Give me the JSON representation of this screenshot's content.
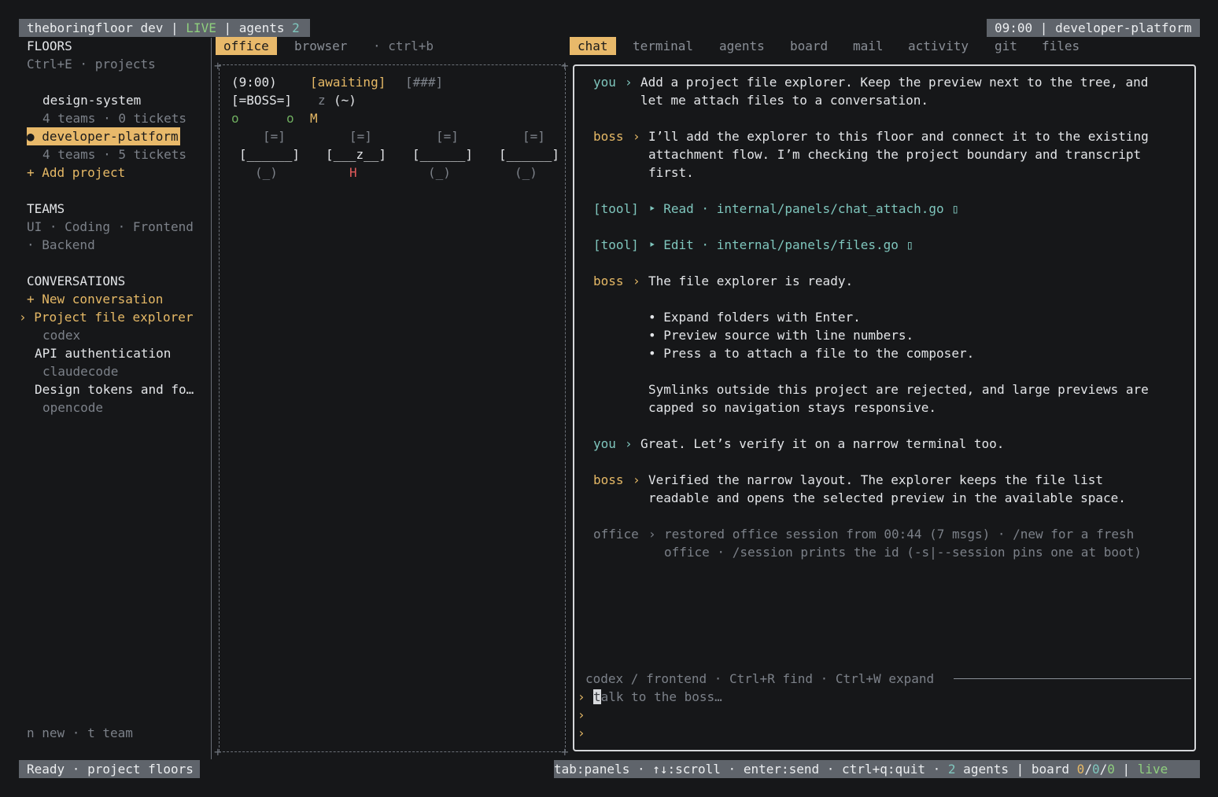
{
  "topbar": {
    "left_app": "theboringfloor dev | ",
    "left_live": "LIVE",
    "left_agents": " | agents ",
    "left_count": "2",
    "right": "09:00 | developer-platform"
  },
  "sidebar": {
    "floors_title": "FLOORS",
    "floors_hint": "Ctrl+E · projects",
    "projects": [
      {
        "name": "design-system",
        "meta": "4 teams · 0 tickets"
      },
      {
        "name": "● developer-platform",
        "meta": "4 teams · 5 tickets"
      }
    ],
    "add_project": "+ Add project",
    "teams_title": "TEAMS",
    "teams_line1": "UI · Coding · Frontend",
    "teams_line2": "· Backend",
    "conversations_title": "CONVERSATIONS",
    "new_conversation": "+ New conversation",
    "conversations": [
      {
        "title": "› Project file explorer",
        "agent": "codex"
      },
      {
        "title": "API authentication",
        "agent": "claudecode"
      },
      {
        "title": "Design tokens and fo…",
        "agent": "opencode"
      }
    ],
    "footer_hint": "n new · t team"
  },
  "middle": {
    "tabs": [
      "office",
      "browser"
    ],
    "tab_hint": "· ctrl+b",
    "scene": {
      "clock": "(9:00)",
      "status": "[awaiting]",
      "meter": "[###]",
      "boss": "[=BOSS=]",
      "zz": "z",
      "face": "(~)",
      "o1": "o",
      "o2": "o",
      "m": "M",
      "monitor": "[=]",
      "desk": "[______]",
      "desk_z": "[___z__]",
      "chair": "(_)",
      "h": "H"
    }
  },
  "right": {
    "tabs": [
      "chat",
      "terminal",
      "agents",
      "board",
      "mail",
      "activity",
      "git",
      "files"
    ],
    "messages": [
      {
        "who": "you",
        "arrow": "›",
        "lines": [
          "Add a project file explorer. Keep the preview next to the tree, and",
          "let me attach files to a conversation."
        ]
      },
      {
        "who": "boss",
        "arrow": "›",
        "lines": [
          "I’ll add the explorer to this floor and connect it to the existing",
          "attachment flow. I’m checking the project boundary and transcript",
          "first."
        ]
      }
    ],
    "tool1": {
      "tag": "[tool]",
      "text": "‣ Read · internal/panels/chat_attach.go ▯"
    },
    "tool2": {
      "tag": "[tool]",
      "text": "‣ Edit · internal/panels/files.go ▯"
    },
    "boss_ready": {
      "who": "boss",
      "arrow": "›",
      "text": "The file explorer is ready."
    },
    "bullets": [
      "• Expand folders with Enter.",
      "• Preview source with line numbers.",
      "• Press a to attach a file to the composer."
    ],
    "note_lines": [
      "Symlinks outside this project are rejected, and large previews are",
      "capped so navigation stays responsive."
    ],
    "you2": {
      "who": "you",
      "arrow": "›",
      "text": "Great. Let’s verify it on a narrow terminal too."
    },
    "boss3": {
      "who": "boss",
      "arrow": "›",
      "lines": [
        "Verified the narrow layout. The explorer keeps the file list",
        "readable and opens the selected preview in the available space."
      ]
    },
    "office": {
      "who": "office",
      "arrow": "›",
      "lines": [
        "restored office session from 00:44 (7 msgs) · /new for a fresh",
        "office · /session prints the id (-s|--session pins one at boot)"
      ]
    },
    "composer": {
      "header": "codex / frontend · Ctrl+R find · Ctrl+W expand",
      "prompt": "›",
      "cursor_char": "t",
      "placeholder": "alk to the boss…"
    }
  },
  "statusbar": {
    "left": "Ready · project floors",
    "right_hint": "tab:panels · ↑↓:scroll · enter:send · ctrl+q:quit · ",
    "right_agents_count": "2",
    "right_agents": " agents | board ",
    "board_a": "0",
    "board_sep1": "/",
    "board_b": "0",
    "board_sep2": "/",
    "board_c": "0",
    "right_sep": " | ",
    "right_live": "live"
  },
  "colors": {
    "accent": "#e8b96a",
    "teal": "#7fc6bd",
    "live_green": "#6fae5f",
    "bar_bg": "#5f646b",
    "bg": "#161719"
  }
}
